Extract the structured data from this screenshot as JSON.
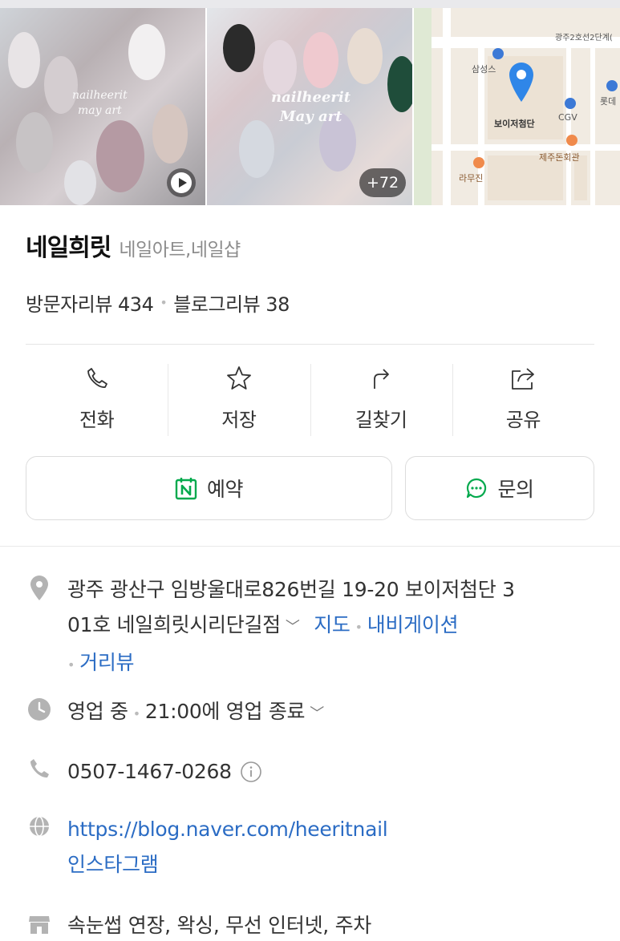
{
  "gallery": {
    "photo1_watermark": [
      "nailheerit",
      "may art"
    ],
    "photo2_watermark": [
      "nailheerit",
      "May art"
    ],
    "more_count": "+72"
  },
  "map": {
    "labels": {
      "road": "광주2호선2단계(",
      "samsung": "삼성스",
      "lotte": "롯데",
      "boyjeo": "보이저첨단",
      "cgv": "CGV",
      "jeju": "제주돈회관",
      "ramu": "라무진"
    },
    "pin_color": "#2f86e8"
  },
  "place": {
    "name": "네일희릿",
    "category": "네일아트,네일샵",
    "visitor_reviews": "방문자리뷰 434",
    "blog_reviews": "블로그리뷰 38"
  },
  "actions": [
    {
      "label": "전화",
      "icon": "phone-icon"
    },
    {
      "label": "저장",
      "icon": "star-icon"
    },
    {
      "label": "길찾기",
      "icon": "directions-icon"
    },
    {
      "label": "공유",
      "icon": "share-icon"
    }
  ],
  "buttons": {
    "reserve": "예약",
    "inquiry": "문의"
  },
  "info": {
    "address_line1": "광주 광산구 임방울대로826번길 19-20 보이저첨단 3",
    "address_line2": "01호 네일희릿시리단길점",
    "map_link": "지도",
    "navi_link": "내비게이션",
    "street_link": "거리뷰",
    "hours_status": "영업 중",
    "hours_detail": "21:00에 영업 종료",
    "phone": "0507-1467-0268",
    "website": "https://blog.naver.com/heeritnail",
    "instagram": "인스타그램",
    "amenities": "속눈썹 연장, 왁싱, 무선 인터넷, 주차"
  },
  "colors": {
    "link": "#2b6cc4",
    "naver_green": "#03a94d",
    "icon_gray": "#b3b3b3"
  }
}
